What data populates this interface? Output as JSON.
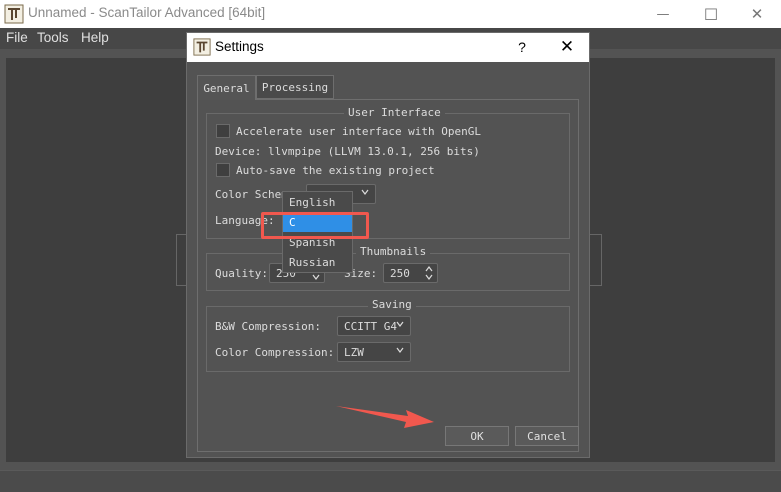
{
  "window": {
    "title": "Unnamed - ScanTailor Advanced [64bit]",
    "minimize_glyph": "—",
    "maximize_glyph": "☐",
    "close_glyph": "✕"
  },
  "menu": [
    "File",
    "Tools",
    "Help"
  ],
  "dialog": {
    "title": "Settings",
    "help_glyph": "?",
    "close_glyph": "✕",
    "tabs": [
      "General",
      "Processing"
    ],
    "user_interface": {
      "legend": "User Interface",
      "opengl_label": "Accelerate user interface with OpenGL",
      "opengl_checked": false,
      "device": "Device: llvmpipe (LLVM 13.0.1, 256 bits)",
      "autosave_label": "Auto-save the existing project",
      "autosave_checked": false,
      "color_scheme_label": "Color Scheme:",
      "language_label": "Language:"
    },
    "thumbnails": {
      "legend": "Thumbnails",
      "quality_label": "Quality:",
      "quality_value": "250",
      "size_label": "Size:",
      "size_value": "250"
    },
    "saving": {
      "legend": "Saving",
      "bw_label": "B&W Compression:",
      "bw_value": "CCITT G4",
      "color_label": "Color Compression:",
      "color_value": "LZW"
    },
    "ok_label": "OK",
    "cancel_label": "Cancel"
  },
  "language_dropdown": {
    "options": [
      "English",
      "C",
      "Spanish",
      "Russian"
    ],
    "highlighted": "C"
  },
  "colors": {
    "highlight": "#2f8fe6",
    "annotation": "#f1584e"
  }
}
